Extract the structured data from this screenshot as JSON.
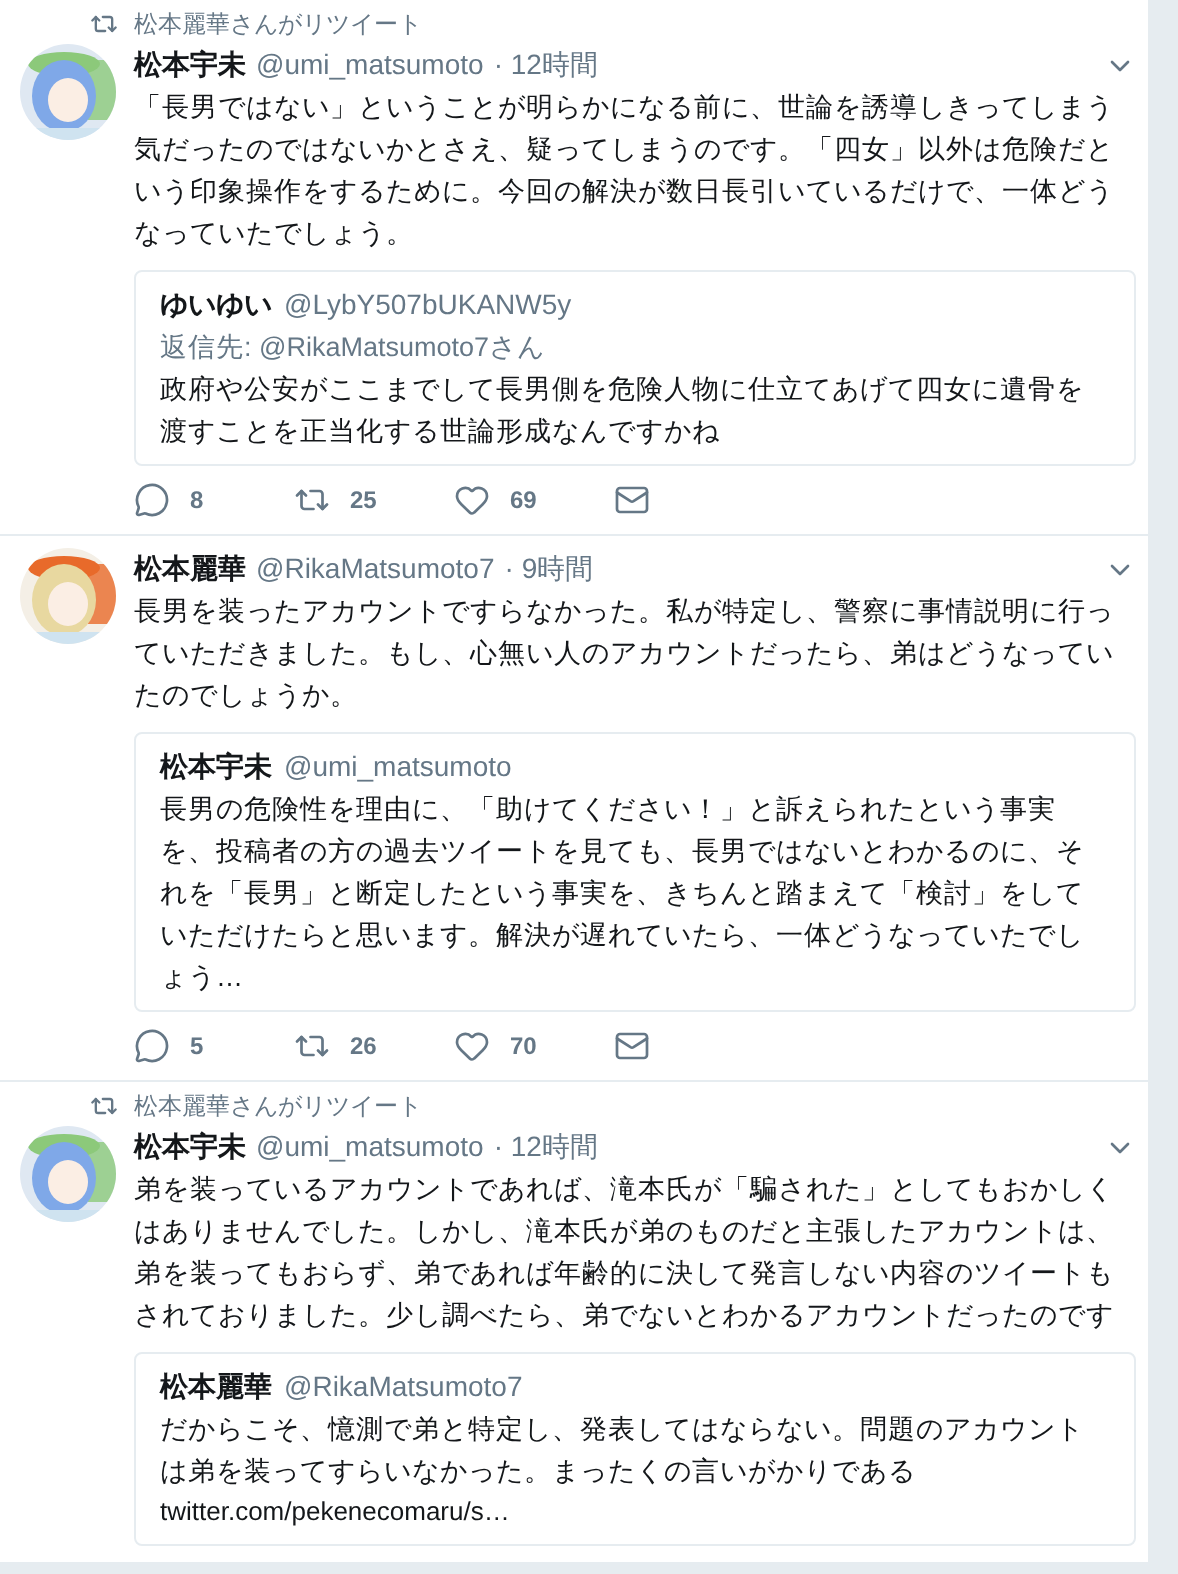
{
  "tweets": [
    {
      "retweeted_by": "松本麗華さんがリツイート",
      "name": "松本宇未",
      "handle": "@umi_matsumoto",
      "time": "· 12時間",
      "text": "「長男ではない」ということが明らかになる前に、世論を誘導しきってしまう気だったのではないかとさえ、疑ってしまうのです。「四女」以外は危険だという印象操作をするために。今回の解決が数日長引いているだけで、一体どうなっていたでしょう。",
      "quote": {
        "name": "ゆいゆい",
        "handle": "@LybY507bUKANW5y",
        "reply_to": "返信先: @RikaMatsumoto7さん",
        "text": "政府や公安がここまでして長男側を危険人物に仕立てあげて四女に遺骨を渡すことを正当化する世論形成なんですかね"
      },
      "actions": {
        "replies": "8",
        "retweets": "25",
        "likes": "69"
      }
    },
    {
      "name": "松本麗華",
      "handle": "@RikaMatsumoto7",
      "time": "· 9時間",
      "text": "長男を装ったアカウントですらなかった。私が特定し、警察に事情説明に行っていただきました。もし、心無い人のアカウントだったら、弟はどうなっていたのでしょうか。",
      "quote": {
        "name": "松本宇未",
        "handle": "@umi_matsumoto",
        "text": "長男の危険性を理由に、「助けてください！」と訴えられたという事実を、投稿者の方の過去ツイートを見ても、長男ではないとわかるのに、それを「長男」と断定したという事実を、きちんと踏まえて「検討」をしていただけたらと思います。解決が遅れていたら、一体どうなっていたでしょう…"
      },
      "actions": {
        "replies": "5",
        "retweets": "26",
        "likes": "70"
      }
    },
    {
      "retweeted_by": "松本麗華さんがリツイート",
      "name": "松本宇未",
      "handle": "@umi_matsumoto",
      "time": "· 12時間",
      "text": "弟を装っているアカウントであれば、滝本氏が「騙された」としてもおかしくはありませんでした。しかし、滝本氏が弟のものだと主張したアカウントは、弟を装ってもおらず、弟であれば年齢的に決して発言しない内容のツイートもされておりました。少し調べたら、弟でないとわかるアカウントだったのです",
      "quote": {
        "name": "松本麗華",
        "handle": "@RikaMatsumoto7",
        "text": "だからこそ、憶測で弟と特定し、発表してはならない。問題のアカウントは弟を装ってすらいなかった。まったくの言いがかりである",
        "link": "twitter.com/pekenecomaru/s…"
      }
    }
  ]
}
